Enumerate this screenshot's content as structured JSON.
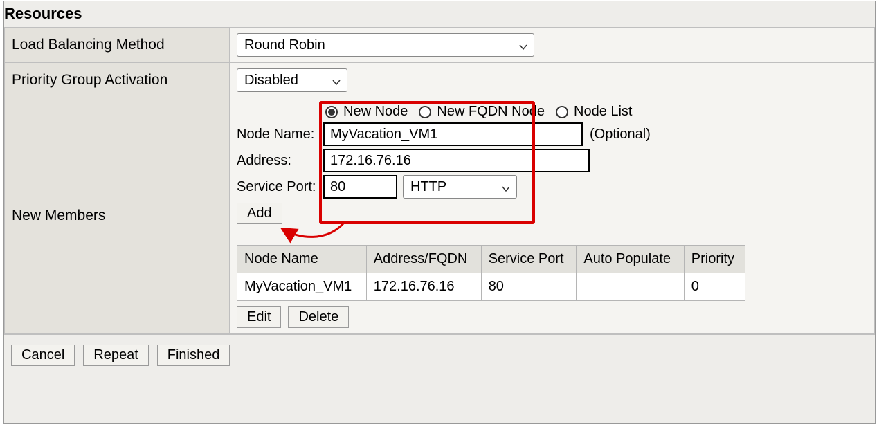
{
  "section_title": "Resources",
  "rows": {
    "lb_method": {
      "label": "Load Balancing Method",
      "value": "Round Robin"
    },
    "pga": {
      "label": "Priority Group Activation",
      "value": "Disabled"
    },
    "new_members": {
      "label": "New Members"
    }
  },
  "node_type": {
    "options": [
      "New Node",
      "New FQDN Node",
      "Node List"
    ],
    "selected": "New Node"
  },
  "node_form": {
    "name_label": "Node Name:",
    "name_value": "MyVacation_VM1",
    "optional_text": "(Optional)",
    "address_label": "Address:",
    "address_value": "172.16.76.16",
    "port_label": "Service Port:",
    "port_value": "80",
    "port_select": "HTTP"
  },
  "buttons": {
    "add": "Add",
    "edit": "Edit",
    "delete": "Delete",
    "cancel": "Cancel",
    "repeat": "Repeat",
    "finished": "Finished"
  },
  "members_table": {
    "headers": [
      "Node Name",
      "Address/FQDN",
      "Service Port",
      "Auto Populate",
      "Priority"
    ],
    "rows": [
      {
        "name": "MyVacation_VM1",
        "address": "172.16.76.16",
        "port": "80",
        "auto": "",
        "priority": "0"
      }
    ]
  }
}
